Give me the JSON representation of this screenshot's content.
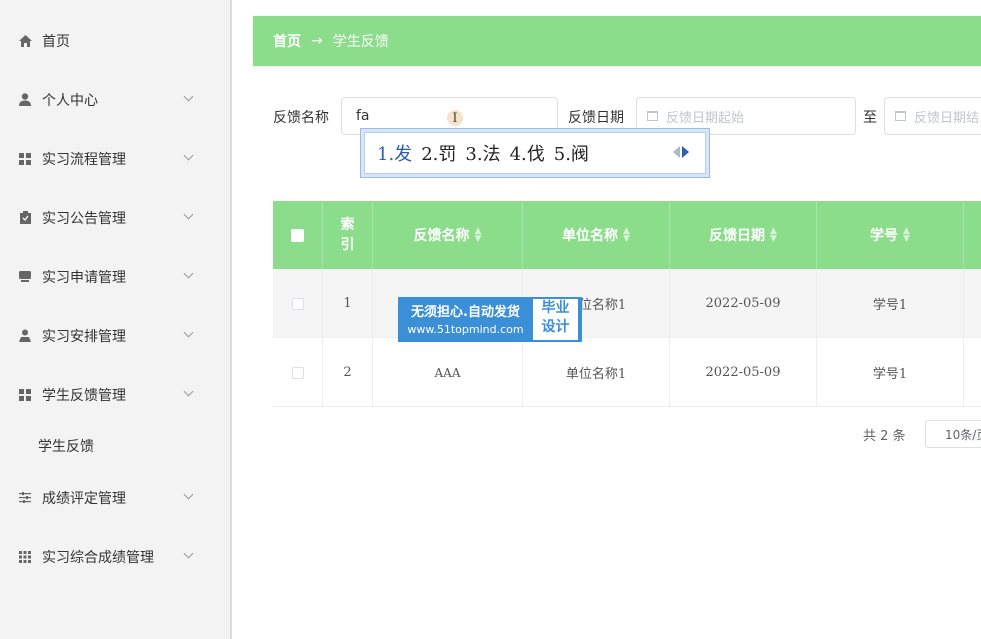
{
  "sidebar": {
    "items": [
      {
        "label": "首页",
        "icon": "home-icon",
        "expandable": false
      },
      {
        "label": "个人中心",
        "icon": "user-icon",
        "expandable": true
      },
      {
        "label": "实习流程管理",
        "icon": "grid-icon",
        "expandable": true
      },
      {
        "label": "实习公告管理",
        "icon": "clipboard-icon",
        "expandable": true
      },
      {
        "label": "实习申请管理",
        "icon": "inbox-icon",
        "expandable": true
      },
      {
        "label": "实习安排管理",
        "icon": "person-icon",
        "expandable": true
      },
      {
        "label": "学生反馈管理",
        "icon": "grid-icon",
        "expandable": true
      },
      {
        "label": "成绩评定管理",
        "icon": "sliders-icon",
        "expandable": true
      },
      {
        "label": "实习综合成绩管理",
        "icon": "apps-icon",
        "expandable": true
      }
    ],
    "submenu": {
      "label": "学生反馈"
    }
  },
  "breadcrumb": {
    "home": "首页",
    "separator": "→",
    "current": "学生反馈"
  },
  "search": {
    "name_label": "反馈名称",
    "name_value": "fa",
    "date_label": "反馈日期",
    "date_start_placeholder": "反馈日期起始",
    "to_label": "至",
    "date_end_placeholder": "反馈日期结"
  },
  "ime": {
    "candidates": [
      "1.发",
      "2.罚",
      "3.法",
      "4.伐",
      "5.阀"
    ]
  },
  "table": {
    "headers": [
      "索引",
      "反馈名称",
      "单位名称",
      "反馈日期",
      "学号"
    ],
    "rows": [
      {
        "index": "1",
        "name": "",
        "unit": "单位名称1",
        "date": "2022-05-09",
        "student_id": "学号1"
      },
      {
        "index": "2",
        "name": "AAA",
        "unit": "单位名称1",
        "date": "2022-05-09",
        "student_id": "学号1"
      }
    ]
  },
  "watermark": {
    "line1": "无须担心.自动发货",
    "line2": "www.51topmind.com",
    "badge_line1": "毕业",
    "badge_line2": "设计"
  },
  "pagination": {
    "total": "共 2 条",
    "page_size": "10条/页"
  },
  "colors": {
    "accent": "#8bdc8b",
    "watermark": "#3b8fd7",
    "ime_selected": "#2b5ea8"
  }
}
